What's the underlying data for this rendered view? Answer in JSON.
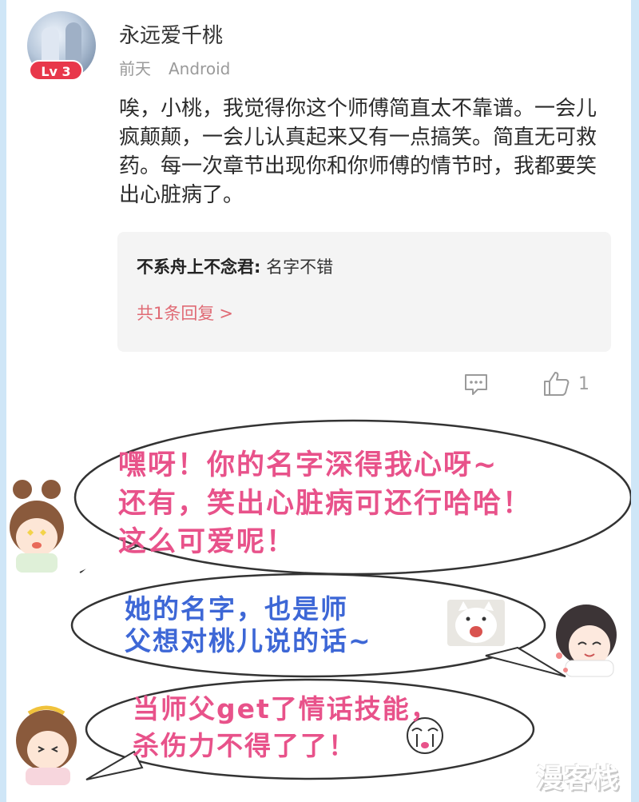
{
  "comment": {
    "level_badge": "Lv 3",
    "username": "永远爱千桃",
    "time": "前天",
    "device": "Android",
    "content": "唉，小桃，我觉得你这个师傅简直太不靠谱。一会儿疯颠颠，一会儿认真起来又有一点搞笑。简直无可救药。每一次章节出现你和你师傅的情节时，我都要笑出心脏病了。",
    "reply": {
      "user": "不系舟上不念君:",
      "text": "名字不错",
      "more": "共1条回复",
      "more_chevron": ">"
    },
    "actions": {
      "comment_icon": "comment-icon",
      "like_icon": "thumbs-up-icon",
      "like_count": "1"
    }
  },
  "comic": {
    "bubble1_lines": [
      "嘿呀！你的名字深得我心呀~",
      "还有，笑出心脏病可还行哈哈！",
      "这么可爱呢！"
    ],
    "bubble2_lines": [
      "她的名字，也是师",
      "父想对桃儿说的话~"
    ],
    "bubble3_lines": [
      "当师父get了情话技能，",
      "杀伤力不得了了！"
    ],
    "watermark": "漫客栈",
    "colors": {
      "pink_text": "#e8528a",
      "blue_text": "#3d67d6",
      "badge": "#e8374a",
      "reply_link": "#e06b75"
    }
  }
}
